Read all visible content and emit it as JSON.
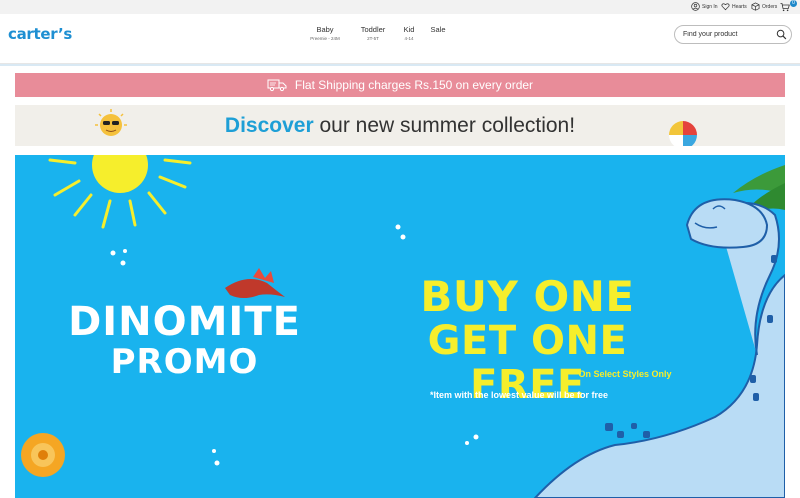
{
  "utility": {
    "sign_in": "Sign In",
    "hearts": "Hearts",
    "orders": "Orders",
    "cart_count": "0"
  },
  "header": {
    "logo": "carter’s",
    "nav": [
      {
        "label": "Baby",
        "sub": "Preemie - 24M"
      },
      {
        "label": "Toddler",
        "sub": "2T-5T"
      },
      {
        "label": "Kid",
        "sub": "4-14"
      },
      {
        "label": "Sale",
        "sub": ""
      }
    ],
    "search_placeholder": "Find your product"
  },
  "shipping_banner": {
    "text": "Flat Shipping charges Rs.150 on every order"
  },
  "discover_banner": {
    "highlight": "Discover",
    "rest": " our new summer collection!"
  },
  "promo": {
    "title_line1": "DINOMITE",
    "title_line2": "PROMO",
    "offer_line1": "BUY ONE",
    "offer_line2": "GET ONE FREE",
    "note1": "*On Select Styles Only",
    "note2": "*Item with the lowest value will be for free"
  },
  "colors": {
    "brand_blue": "#1e8fd2",
    "shipping_pink": "#e88c99",
    "promo_blue": "#19b3ee",
    "promo_yellow": "#f6ee2c"
  },
  "icons": [
    "user-icon",
    "heart-icon",
    "orders-box-icon",
    "cart-icon",
    "search-icon",
    "truck-icon"
  ]
}
